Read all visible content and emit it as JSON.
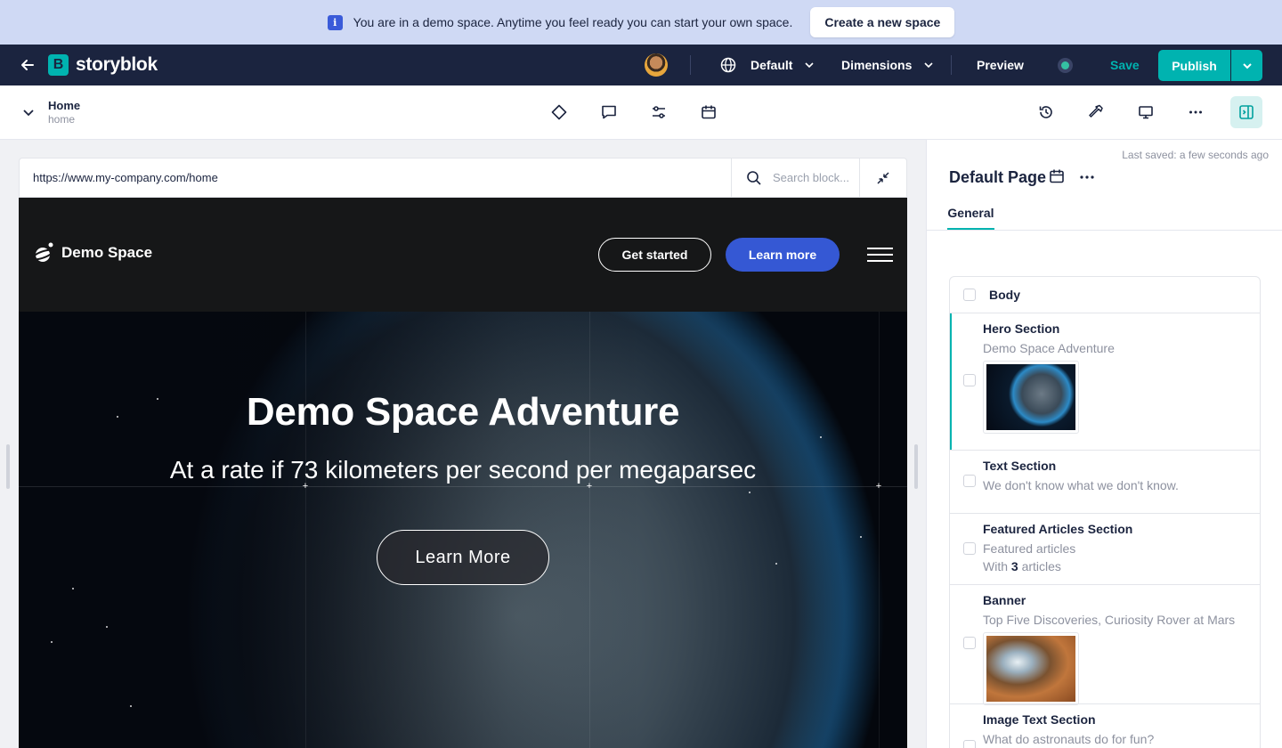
{
  "demo_banner": {
    "text": "You are in a demo space. Anytime you feel ready you can start your own space.",
    "button": "Create a new space"
  },
  "topnav": {
    "brand": "storyblok",
    "language": "Default",
    "dimensions": "Dimensions",
    "preview": "Preview",
    "save": "Save",
    "publish": "Publish"
  },
  "story": {
    "title": "Home",
    "slug": "home"
  },
  "preview": {
    "url": "https://www.my-company.com/home",
    "search_placeholder": "Search block..."
  },
  "site": {
    "logo": "Demo Space",
    "nav_get_started": "Get started",
    "nav_learn_more": "Learn more",
    "hero_title": "Demo Space Adventure",
    "hero_subtitle": "At a rate if 73 kilometers per second per megaparsec",
    "hero_button": "Learn More"
  },
  "panel": {
    "last_saved": "Last saved: a few seconds ago",
    "title": "Default Page",
    "tab": "General",
    "body_label": "Body",
    "bloks": [
      {
        "name": "Hero Section",
        "desc": "Demo Space Adventure"
      },
      {
        "name": "Text Section",
        "desc": "We don't know what we don't know."
      },
      {
        "name": "Featured Articles Section",
        "desc": "Featured articles",
        "extra_prefix": "With",
        "extra_count": "3",
        "extra_suffix": "articles"
      },
      {
        "name": "Banner",
        "desc": "Top Five Discoveries, Curiosity Rover at Mars"
      },
      {
        "name": "Image Text Section",
        "desc": "What do astronauts do for fun?"
      }
    ]
  },
  "colors": {
    "brand_teal": "#00b3b0",
    "nav_dark": "#1b243f",
    "demo_banner_bg": "#cfd9f4",
    "site_primary_blue": "#3558d4"
  },
  "icons": [
    "info-icon",
    "back-arrow-icon",
    "storyblok-logo-icon",
    "globe-icon",
    "chevron-down-icon",
    "diamond-icon",
    "comment-icon",
    "sliders-icon",
    "calendar-icon",
    "history-icon",
    "hammer-icon",
    "monitor-icon",
    "more-icon",
    "panel-toggle-icon",
    "search-icon",
    "minimize-icon",
    "hamburger-icon"
  ]
}
